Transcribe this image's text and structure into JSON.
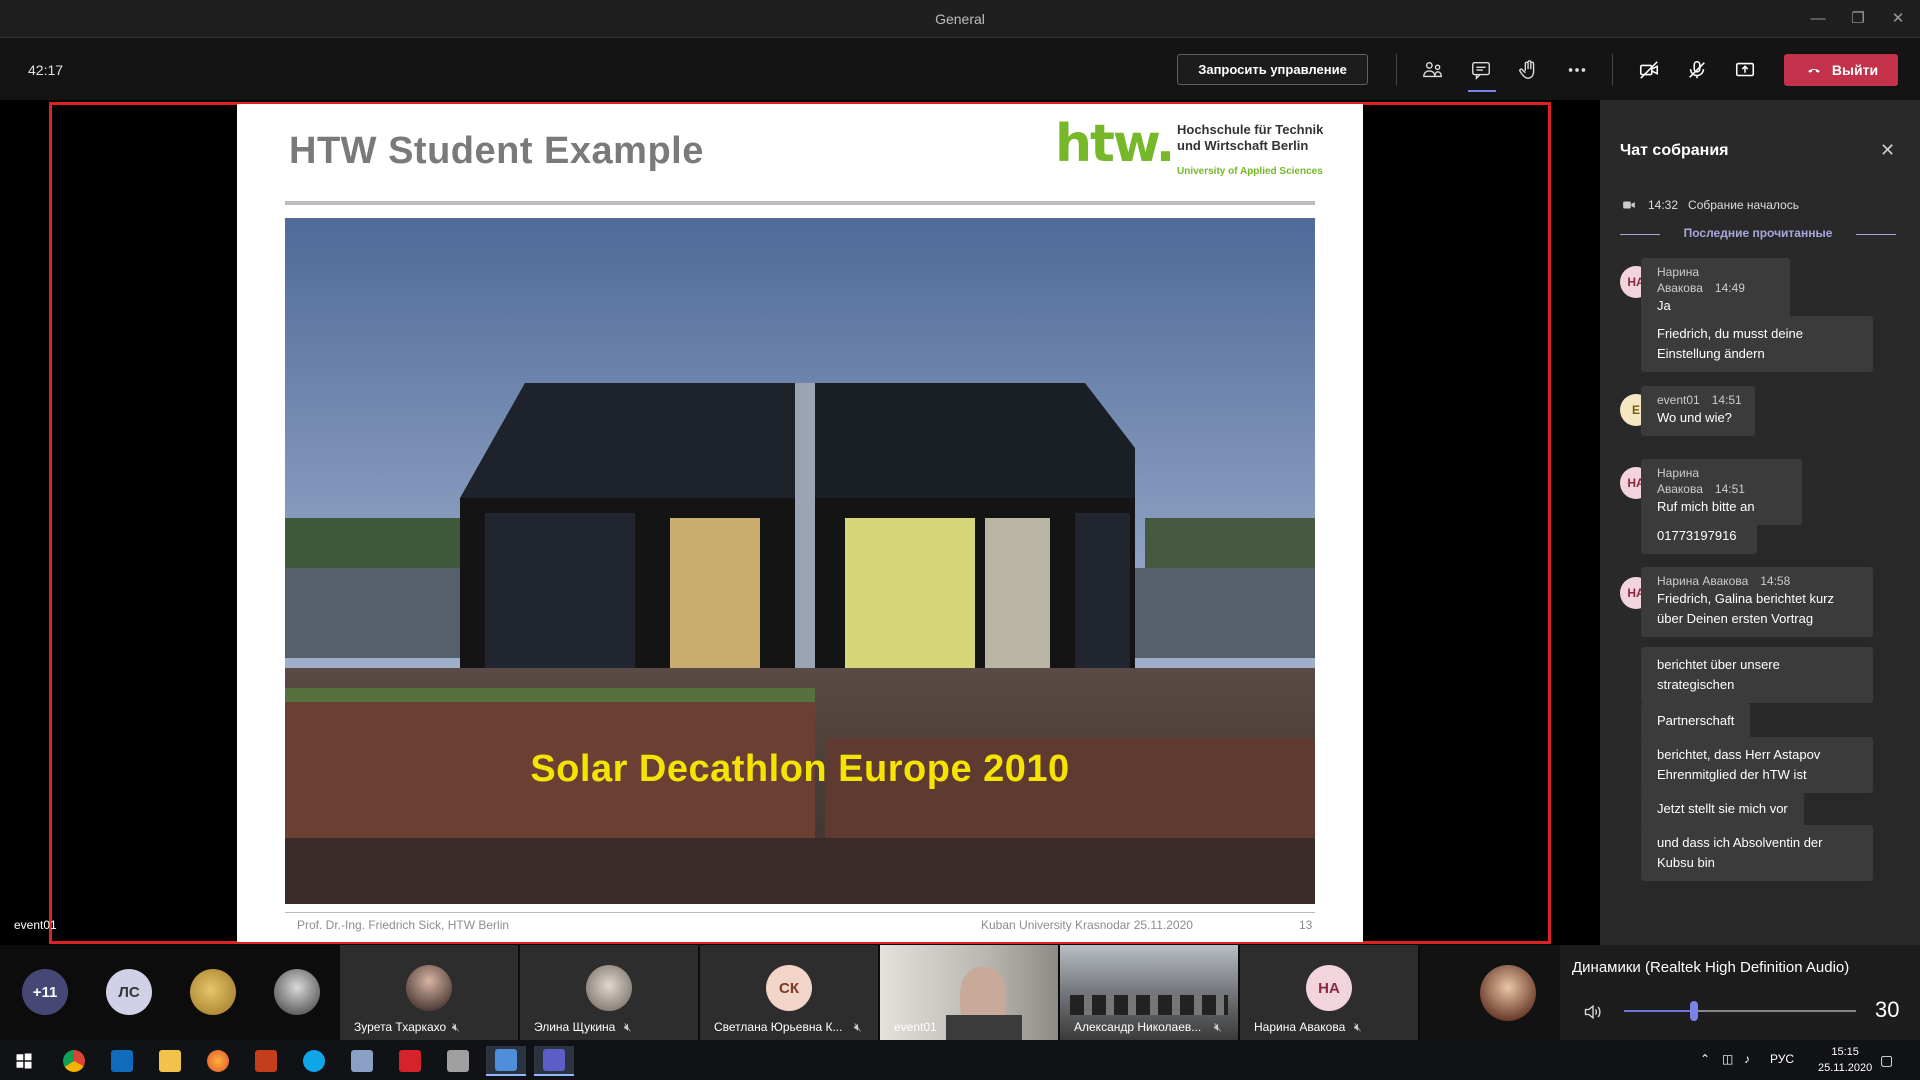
{
  "window": {
    "title": "General"
  },
  "toolbar": {
    "timer": "42:17",
    "request_control_label": "Запросить управление",
    "leave_label": "Выйти",
    "leave_color": "#c4314b"
  },
  "slide": {
    "title": "HTW Student Example",
    "logo_text": "htw.",
    "institution_line1": "Hochschule für Technik",
    "institution_line2": "und Wirtschaft Berlin",
    "institution_sub": "University of Applied Sciences",
    "photo_caption": "Solar Decathlon Europe 2010",
    "footer_left": "Prof. Dr.-Ing. Friedrich Sick, HTW Berlin",
    "footer_right": "Kuban University Krasnodar 25.11.2020",
    "page_number": "13"
  },
  "presenter": {
    "name": "event01"
  },
  "chat": {
    "title": "Чат собрания",
    "system_time": "14:32",
    "system_text": "Собрание началось",
    "last_read_label": "Последние прочитанные",
    "messages": [
      {
        "initials": "НА",
        "author": "Нарина Авакова",
        "time": "14:49",
        "lines": [
          "Ja",
          "Friedrich, du musst deine Einstellung ändern"
        ]
      },
      {
        "initials": "E",
        "author": "event01",
        "time": "14:51",
        "lines": [
          "Wo und wie?"
        ]
      },
      {
        "initials": "НА",
        "author": "Нарина Авакова",
        "time": "14:51",
        "lines": [
          "Ruf mich bitte an",
          "01773197916"
        ]
      },
      {
        "initials": "НА",
        "author": "Нарина Авакова",
        "time": "14:58",
        "lines": [
          "Friedrich, Galina berichtet kurz über Deinen ersten Vortrag",
          "berichtet über unsere strategischen",
          "Partnerschaft",
          "berichtet, dass Herr Astapov Ehrenmitglied der hTW ist",
          "Jetzt stellt sie mich vor",
          "und dass ich Absolventin der Kubsu bin"
        ]
      }
    ]
  },
  "participants": {
    "overflow_count": "+11",
    "avatar_ls": "ЛС",
    "tiles": [
      {
        "name": "Зурета Тхаркахо"
      },
      {
        "name": "Элина Щукина"
      },
      {
        "name": "Светлана Юрьевна К...",
        "initials": "СК"
      },
      {
        "name": "event01"
      },
      {
        "name": "Александр Николаев..."
      },
      {
        "name": "Нарина Авакова",
        "initials": "НА"
      }
    ]
  },
  "audio": {
    "device_name": "Динамики (Realtek High Definition Audio)",
    "volume": "30",
    "volume_fraction": 0.3
  },
  "taskbar": {
    "language": "РУС",
    "time": "15:15",
    "date": "25.11.2020"
  }
}
